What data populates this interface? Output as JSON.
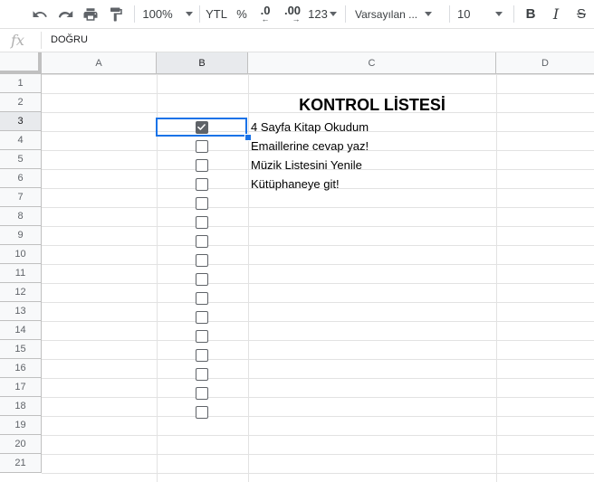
{
  "toolbar": {
    "zoom": "100%",
    "currency": "YTL",
    "percent": "%",
    "decrease_decimal": ".0",
    "increase_decimal": ".00",
    "number_format": "123",
    "font": "Varsayılan ...",
    "font_size": "10",
    "bold": "B",
    "italic": "I",
    "strike": "S"
  },
  "formula_bar": {
    "fx": "fx",
    "value": "DOĞRU"
  },
  "columns": [
    "A",
    "B",
    "C",
    "D"
  ],
  "rows": [
    "1",
    "2",
    "3",
    "4",
    "5",
    "6",
    "7",
    "8",
    "9",
    "10",
    "11",
    "12",
    "13",
    "14",
    "15",
    "16",
    "17",
    "18",
    "19",
    "20",
    "21"
  ],
  "sheet": {
    "title": "KONTROL LİSTESİ",
    "tasks": [
      "4 Sayfa Kitap Okudum",
      "Emaillerine cevap yaz!",
      "Müzik Listesini Yenile",
      "Kütüphaneye git!"
    ],
    "checkboxes": [
      true,
      false,
      false,
      false,
      false,
      false,
      false,
      false,
      false,
      false,
      false,
      false,
      false,
      false,
      false,
      false
    ]
  },
  "colors": {
    "selection": "#1a73e8",
    "header_bg": "#f8f9fa",
    "gridline": "#e2e2e2",
    "checkbox": "#5f6368"
  }
}
